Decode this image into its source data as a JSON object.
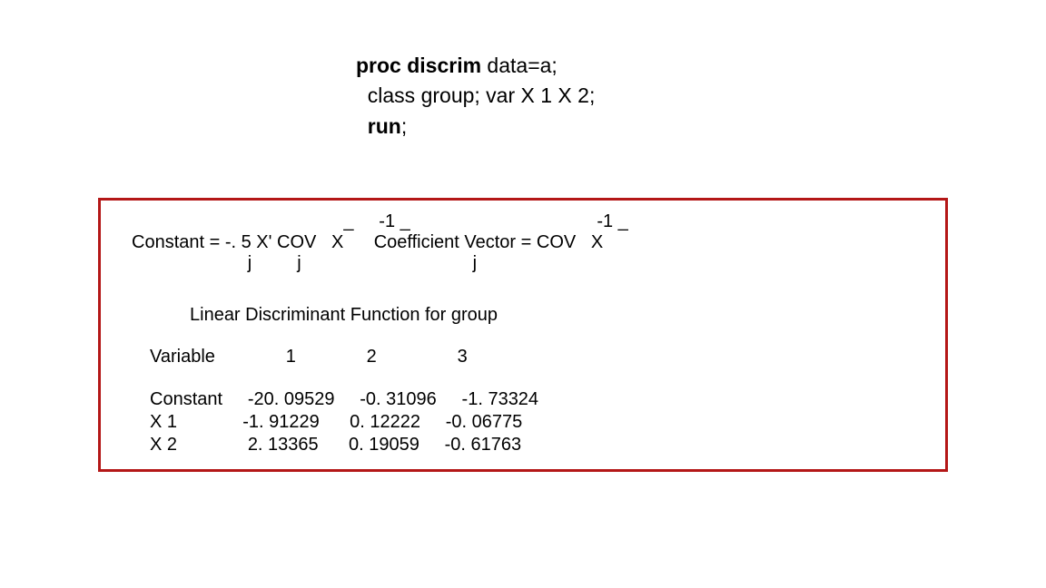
{
  "code": {
    "line1_bold": "proc discrim",
    "line1_rest": " data=a;",
    "line2": "  class group; var X 1 X 2;",
    "line3_pre": "  ",
    "line3_bold": "run",
    "line3_post": ";"
  },
  "formula": {
    "row1": "                                          _     -1 _                                     -1 _",
    "row2": "Constant = -. 5 X' COV   X      Coefficient Vector = COV   X",
    "row3": "                       j         j                                  j"
  },
  "ldf_title": "Linear Discriminant Function for group",
  "table": {
    "header": "Variable              1              2                3",
    "rows": [
      "Constant     -20. 09529     -0. 31096     -1. 73324",
      "X 1             -1. 91229      0. 12222     -0. 06775",
      "X 2              2. 13365      0. 19059     -0. 61763"
    ]
  }
}
